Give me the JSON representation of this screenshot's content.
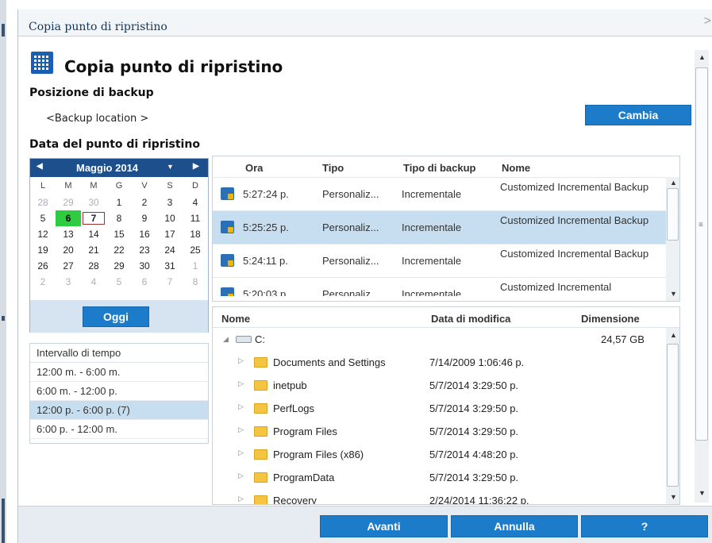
{
  "window": {
    "title": "Copia punto di ripristino",
    "close_glyph": ">"
  },
  "header": {
    "title": "Copia punto di ripristino"
  },
  "backup_location": {
    "label": "Posizione di backup",
    "value": "<Backup location >",
    "change_button": "Cambia"
  },
  "recovery_date": {
    "label": "Data del punto di ripristino",
    "calendar": {
      "month": "Maggio 2014",
      "weekdays": [
        "L",
        "M",
        "M",
        "G",
        "V",
        "S",
        "D"
      ],
      "weeks": [
        [
          "28",
          "29",
          "30",
          "1",
          "2",
          "3",
          "4"
        ],
        [
          "5",
          "6",
          "7",
          "8",
          "9",
          "10",
          "11"
        ],
        [
          "12",
          "13",
          "14",
          "15",
          "16",
          "17",
          "18"
        ],
        [
          "19",
          "20",
          "21",
          "22",
          "23",
          "24",
          "25"
        ],
        [
          "26",
          "27",
          "28",
          "29",
          "30",
          "31",
          "1"
        ],
        [
          "2",
          "3",
          "4",
          "5",
          "6",
          "7",
          "8"
        ]
      ],
      "today_button": "Oggi"
    }
  },
  "time_range": {
    "header": "Intervallo di tempo",
    "items": [
      "12:00 m. - 6:00 m.",
      "6:00 m. - 12:00 p.",
      "12:00 p. - 6:00 p.   (7)",
      "6:00 p. - 12:00 m."
    ]
  },
  "sessions": {
    "columns": [
      "Ora",
      "Tipo",
      "Tipo di backup",
      "Nome"
    ],
    "rows": [
      {
        "time": "5:27:24 p.",
        "type": "Personaliz...",
        "backup_type": "Incrementale",
        "name": "Customized Incremental Backup"
      },
      {
        "time": "5:25:25 p.",
        "type": "Personaliz...",
        "backup_type": "Incrementale",
        "name": "Customized Incremental Backup"
      },
      {
        "time": "5:24:11 p.",
        "type": "Personaliz...",
        "backup_type": "Incrementale",
        "name": "Customized Incremental Backup"
      },
      {
        "time": "5:20:03 p.",
        "type": "Personaliz...",
        "backup_type": "Incrementale",
        "name": "Customized Incremental"
      }
    ]
  },
  "files": {
    "columns": [
      "Nome",
      "Data di modifica",
      "Dimensione"
    ],
    "drive": {
      "name": "C:",
      "size": "24,57 GB"
    },
    "rows": [
      {
        "name": "Documents and Settings",
        "modified": "7/14/2009 1:06:46 p."
      },
      {
        "name": "inetpub",
        "modified": "5/7/2014 3:29:50 p."
      },
      {
        "name": "PerfLogs",
        "modified": "5/7/2014 3:29:50 p."
      },
      {
        "name": "Program Files",
        "modified": "5/7/2014 3:29:50 p."
      },
      {
        "name": "Program Files (x86)",
        "modified": "5/7/2014 4:48:20 p."
      },
      {
        "name": "ProgramData",
        "modified": "5/7/2014 3:29:50 p."
      },
      {
        "name": "Recovery",
        "modified": "2/24/2014 11:36:22 p."
      }
    ]
  },
  "footer": {
    "next": "Avanti",
    "cancel": "Annulla",
    "help": "?"
  },
  "colors": {
    "accent": "#1c7cc9",
    "calendar_header": "#1c4f8c",
    "selection": "#c7def0",
    "today": "#2ecc40"
  }
}
